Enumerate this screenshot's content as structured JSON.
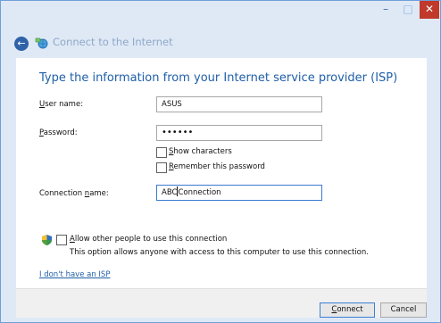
{
  "window": {
    "title_controls": {
      "minimize": "–",
      "maximize": "□",
      "close": "✕"
    }
  },
  "nav": {
    "back_glyph": "←",
    "title": "Connect to the Internet"
  },
  "form": {
    "heading": "Type the information from your Internet service provider (ISP)",
    "user_name": {
      "label_ul": "U",
      "label_rest": "ser name:",
      "value": "ASUS"
    },
    "password": {
      "label_ul": "P",
      "label_rest": "assword:",
      "masked_value": "••••••"
    },
    "show_characters": {
      "label_ul": "S",
      "label_rest": "how characters",
      "checked": false
    },
    "remember_password": {
      "label_ul": "R",
      "label_rest": "emember this password",
      "checked": false
    },
    "connection_name": {
      "label_pre": "Connection ",
      "label_ul": "n",
      "label_rest": "ame:",
      "value_before_caret": "ABC",
      "value_after_caret": "Connection"
    },
    "allow_others": {
      "label_ul": "A",
      "label_rest": "llow other people to use this connection",
      "checked": false,
      "description": "This option allows anyone with access to this computer to use this connection."
    },
    "no_isp_link": "I don't have an ISP"
  },
  "buttons": {
    "connect_ul": "C",
    "connect_rest": "onnect",
    "cancel": "Cancel"
  },
  "colors": {
    "heading": "#1f5fa8",
    "title_bar": "#dfe9f6",
    "close_button": "#c0392b",
    "link": "#1f5fa8"
  }
}
